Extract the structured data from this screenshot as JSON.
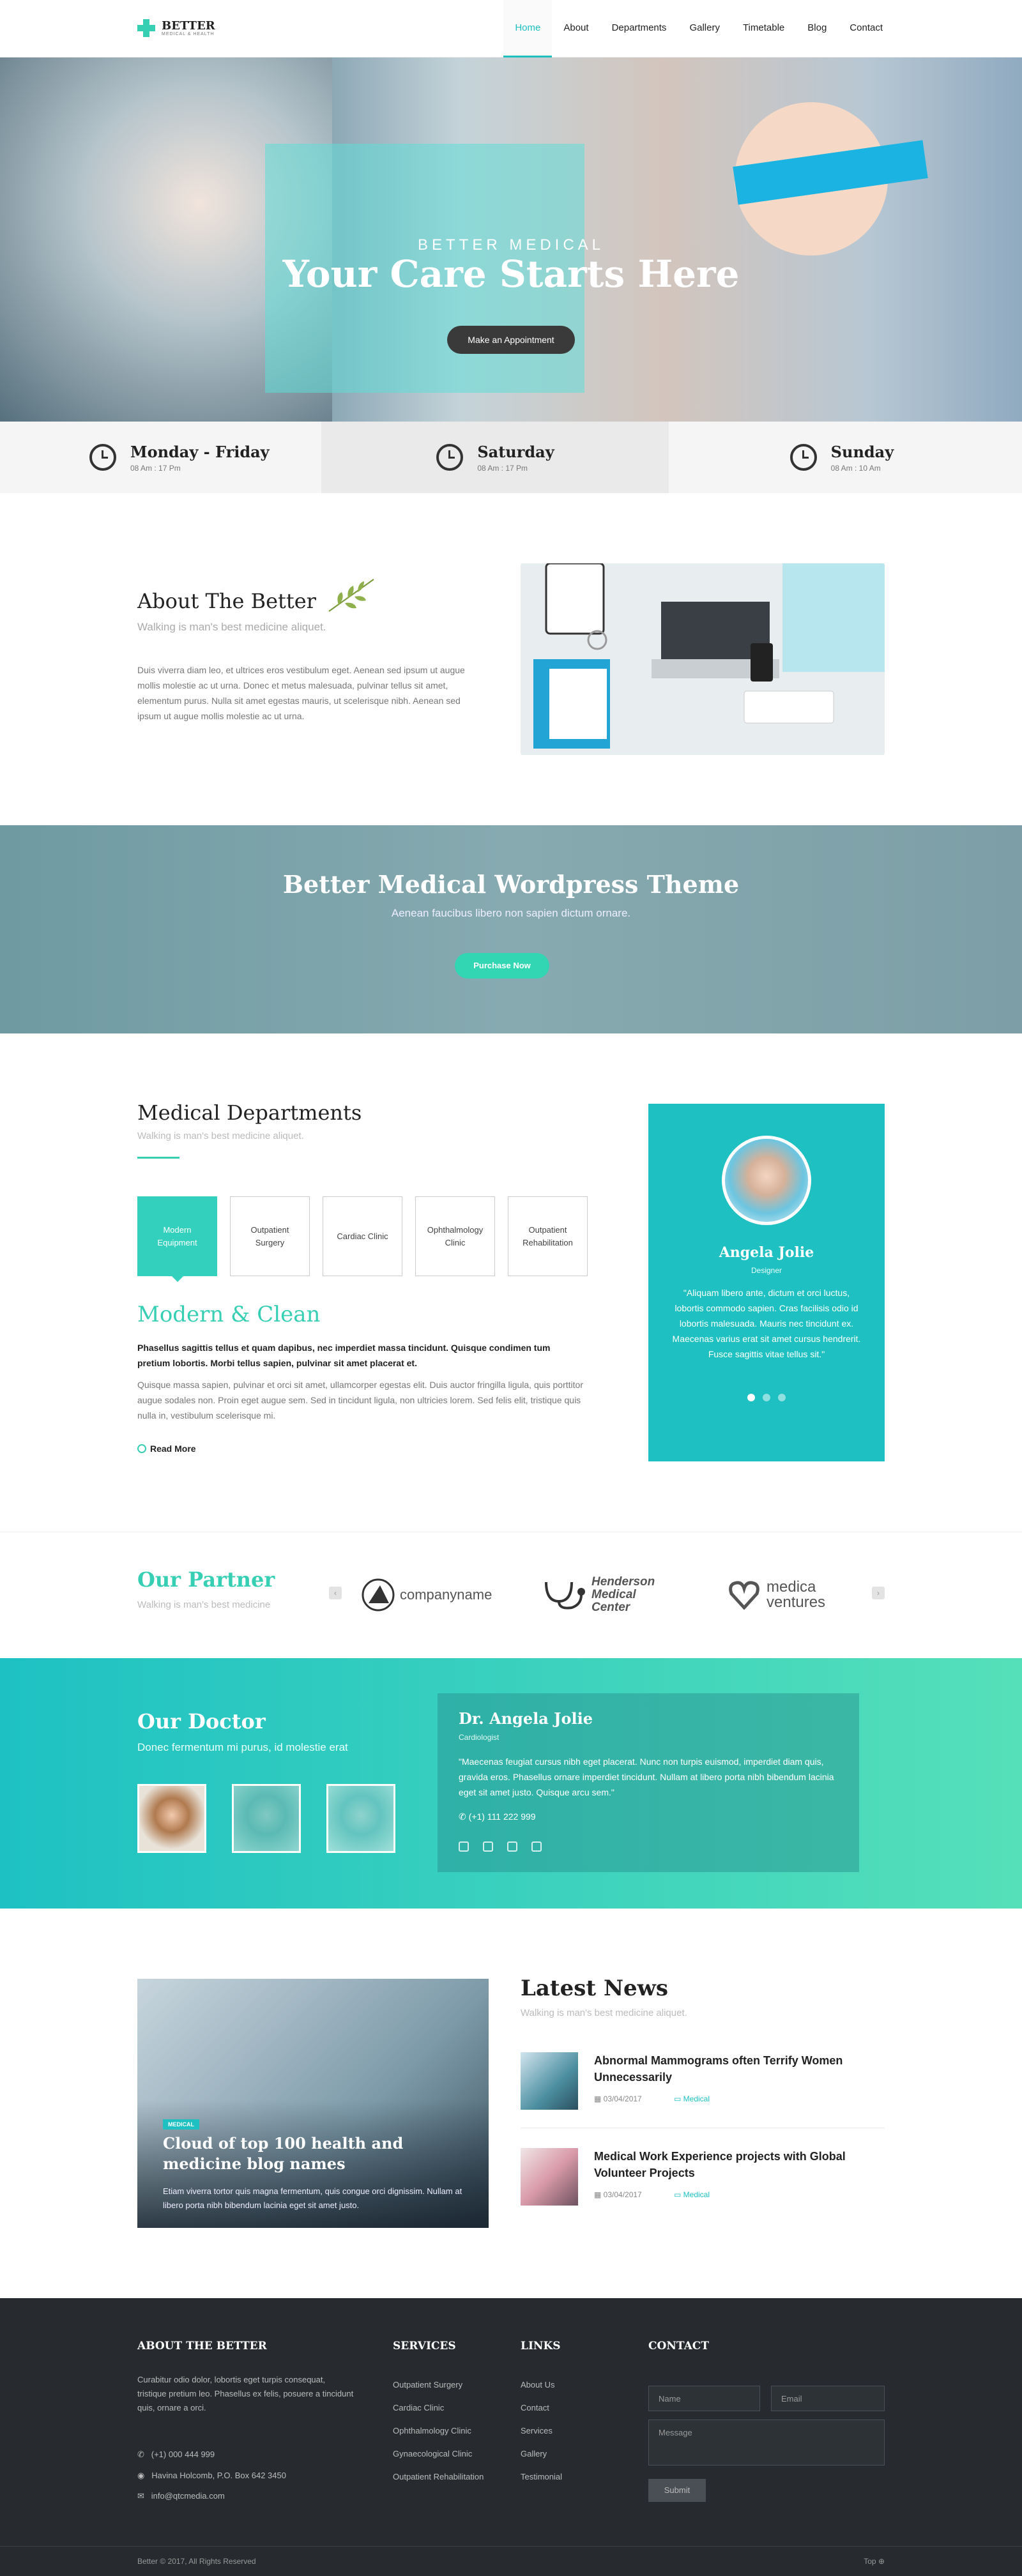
{
  "header": {
    "logo_name": "BETTER",
    "logo_tag": "MEDICAL & HEALTH",
    "nav": [
      "Home",
      "About",
      "Departments",
      "Gallery",
      "Timetable",
      "Blog",
      "Contact"
    ]
  },
  "hero": {
    "subtitle": "BETTER MEDICAL",
    "title": "Your Care Starts Here",
    "button": "Make an Appointment"
  },
  "hours": [
    {
      "day": "Monday - Friday",
      "time": "08 Am : 17 Pm"
    },
    {
      "day": "Saturday",
      "time": "08 Am : 17 Pm"
    },
    {
      "day": "Sunday",
      "time": "08 Am : 10 Am"
    }
  ],
  "about": {
    "title": "About The Better",
    "subtitle": "Walking is man's best medicine aliquet.",
    "text": "Duis viverra diam leo, et ultrices eros vestibulum eget. Aenean sed ipsum ut augue mollis molestie ac ut urna. Donec et metus malesuada, pulvinar tellus sit amet, elementum purus. Nulla sit amet egestas mauris, ut scelerisque nibh. Aenean sed ipsum ut augue mollis molestie ac ut urna."
  },
  "banner": {
    "title": "Better Medical Wordpress Theme",
    "subtitle": "Aenean faucibus libero non sapien dictum ornare.",
    "button": "Purchase Now"
  },
  "departments": {
    "title": "Medical Departments",
    "subtitle": "Walking is man's best medicine aliquet.",
    "tabs": [
      "Modern Equipment",
      "Outpatient Surgery",
      "Cardiac Clinic",
      "Ophthalmology Clinic",
      "Outpatient Rehabilitation"
    ],
    "heading": "Modern & Clean",
    "bold_text": "Phasellus sagittis tellus et quam dapibus, nec imperdiet massa tincidunt. Quisque condimen tum pretium lobortis. Morbi tellus sapien, pulvinar sit amet placerat et.",
    "text": "Quisque massa sapien, pulvinar et orci sit amet, ullamcorper egestas elit. Duis auctor fringilla ligula, quis porttitor augue sodales non. Proin eget augue sem. Sed in tincidunt ligula, non ultricies lorem. Sed felis elit, tristique quis nulla in, vestibulum scelerisque mi.",
    "read_more": "Read More"
  },
  "testimonial": {
    "name": "Angela Jolie",
    "role": "Designer",
    "quote": "\"Aliquam libero ante, dictum et orci luctus, lobortis commodo sapien. Cras facilisis odio id lobortis malesuada. Mauris nec tincidunt ex. Maecenas varius erat sit amet cursus hendrerit. Fusce sagittis vitae tellus sit.\""
  },
  "partner": {
    "title": "Our Partner",
    "subtitle": "Walking is man's best medicine",
    "logos": [
      "companyname",
      "Henderson Medical Center",
      "medica ventures"
    ]
  },
  "doctor": {
    "title": "Our Doctor",
    "subtitle": "Donec fermentum mi purus, id molestie erat",
    "name": "Dr. Angela Jolie",
    "role": "Cardiologist",
    "quote": "\"Maecenas feugiat cursus nibh eget placerat. Nunc non turpis euismod, imperdiet diam quis, gravida eros. Phasellus ornare imperdiet tincidunt. Nullam at libero porta nibh bibendum lacinia eget sit amet justo. Quisque arcu sem.\"",
    "phone": "(+1) 111 222 999"
  },
  "news": {
    "title": "Latest News",
    "subtitle": "Walking is man's best medicine aliquet.",
    "featured": {
      "tag": "MEDICAL",
      "title": "Cloud of top 100 health and medicine blog names",
      "text": "Etiam viverra tortor quis magna fermentum, quis congue orci dignissim. Nullam at libero porta nibh bibendum lacinia eget sit amet justo."
    },
    "items": [
      {
        "title": "Abnormal Mammograms often Terrify Women Unnecessarily",
        "date": "03/04/2017",
        "category": "Medical"
      },
      {
        "title": "Medical Work Experience projects with Global Volunteer Projects",
        "date": "03/04/2017",
        "category": "Medical"
      }
    ]
  },
  "footer": {
    "about_title": "ABOUT THE BETTER",
    "about_text": "Curabitur odio dolor, lobortis eget turpis consequat, tristique pretium leo. Phasellus ex felis, posuere a tincidunt quis, ornare a orci.",
    "phone": "(+1) 000 444 999",
    "address": "Havina Holcomb, P.O. Box 642 3450",
    "email": "info@qtcmedia.com",
    "services_title": "SERVICES",
    "services": [
      "Outpatient Surgery",
      "Cardiac Clinic",
      "Ophthalmology Clinic",
      "Gynaecological Clinic",
      "Outpatient Rehabilitation"
    ],
    "links_title": "LINKS",
    "links": [
      "About Us",
      "Contact",
      "Services",
      "Gallery",
      "Testimonial"
    ],
    "contact_title": "CONTACT",
    "name_placeholder": "Name",
    "email_placeholder": "Email",
    "message_placeholder": "Message",
    "submit": "Submit",
    "copyright": "Better © 2017, All Rights Reserved",
    "top": "Top"
  }
}
